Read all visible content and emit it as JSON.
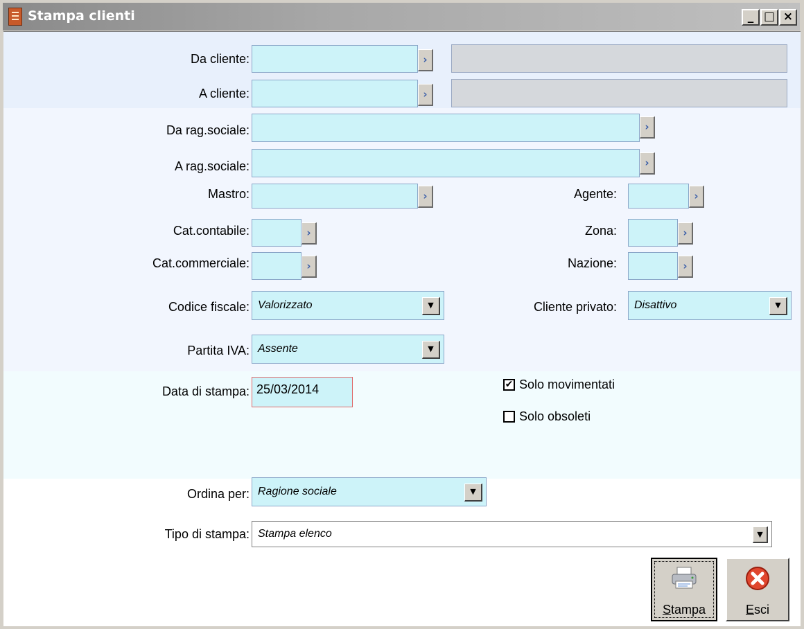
{
  "window": {
    "title": "Stampa clienti",
    "controls": {
      "minimize": "_",
      "maximize": "□",
      "close": "×"
    }
  },
  "form": {
    "da_cliente": {
      "label": "Da cliente:",
      "value": "",
      "description": ""
    },
    "a_cliente": {
      "label": "A cliente:",
      "value": "",
      "description": ""
    },
    "da_rag_sociale": {
      "label": "Da rag.sociale:",
      "value": ""
    },
    "a_rag_sociale": {
      "label": "A rag.sociale:",
      "value": ""
    },
    "mastro": {
      "label": "Mastro:",
      "value": ""
    },
    "agente": {
      "label": "Agente:",
      "value": ""
    },
    "cat_contabile": {
      "label": "Cat.contabile:",
      "value": ""
    },
    "zona": {
      "label": "Zona:",
      "value": ""
    },
    "cat_commerciale": {
      "label": "Cat.commerciale:",
      "value": ""
    },
    "nazione": {
      "label": "Nazione:",
      "value": ""
    },
    "codice_fiscale": {
      "label": "Codice fiscale:",
      "value": "Valorizzato"
    },
    "cliente_privato": {
      "label": "Cliente privato:",
      "value": "Disattivo"
    },
    "partita_iva": {
      "label": "Partita IVA:",
      "value": "Assente"
    },
    "data_stampa": {
      "label": "Data di stampa:",
      "value": "25/03/2014"
    },
    "solo_movimentati": {
      "label": "Solo movimentati",
      "checked": true
    },
    "solo_obsoleti": {
      "label": "Solo obsoleti",
      "checked": false
    },
    "ordina_per": {
      "label": "Ordina per:",
      "value": "Ragione sociale"
    },
    "tipo_stampa": {
      "label": "Tipo di stampa:",
      "value": "Stampa elenco"
    }
  },
  "zoom_glyph": "›",
  "dropdown_glyph": "▼",
  "check_glyph": "✔",
  "buttons": {
    "stampa": {
      "label": "Stampa",
      "icon": "printer-icon"
    },
    "esci": {
      "label": "Esci",
      "icon": "exit-icon"
    }
  },
  "colors": {
    "field_bg": "#cdf3f9",
    "readonly_bg": "#d5d8dc",
    "title_gradient": "#8a8a8a"
  }
}
